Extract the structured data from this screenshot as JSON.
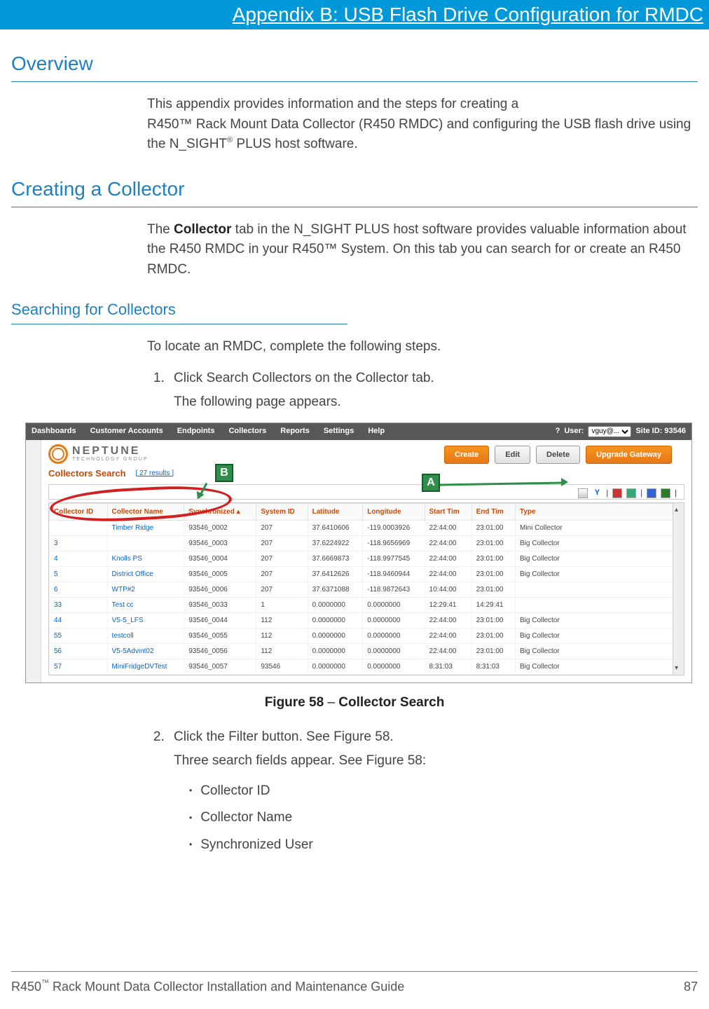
{
  "header_title": "Appendix B: USB Flash Drive Configuration for RMDC",
  "overview": {
    "heading": "Overview",
    "para1_a": "This appendix provides information and the steps for creating a",
    "para1_b": "R450™ Rack Mount Data Collector (R450 RMDC) and configuring the USB flash drive using the N_SIGHT",
    "para1_c": " PLUS host software."
  },
  "creating": {
    "heading": "Creating a Collector",
    "para_a": "The ",
    "para_bold1": "Collector",
    "para_b": " tab in the N_SIGHT PLUS host software provides valuable information about the R450 RMDC in your R450™ System. On this tab you can search for or create an R450 RMDC."
  },
  "searching": {
    "heading": "Searching for Collectors",
    "intro": "To locate an RMDC, complete the following steps.",
    "step1_a": "Click ",
    "step1_b": "Search Collectors",
    "step1_c": " on the ",
    "step1_d": "Collector",
    "step1_e": " tab.",
    "step1_sub": "The following page appears.",
    "step2_a": "Click the ",
    "step2_b": "Filter",
    "step2_c": " button. See Figure 58.",
    "step2_sub": "Three search fields appear. See Figure 58:",
    "bullets": [
      "Collector ID",
      "Collector Name",
      "Synchronized User"
    ]
  },
  "figure": {
    "caption_num": "Figure 58",
    "caption_sep": "  –  ",
    "caption_title": "Collector Search"
  },
  "shot": {
    "menu": [
      "Dashboards",
      "Customer Accounts",
      "Endpoints",
      "Collectors",
      "Reports",
      "Settings",
      "Help"
    ],
    "user_label": "User:",
    "user_value": "vguy@...",
    "site_label": "Site ID: 93546",
    "help_q": "?",
    "logo_big": "NEPTUNE",
    "logo_small": "TECHNOLOGY GROUP",
    "btn_create": "Create",
    "btn_edit": "Edit",
    "btn_delete": "Delete",
    "btn_upgrade": "Upgrade Gateway",
    "search_title": "Collectors Search",
    "results": "[ 27 results ]",
    "filter_y": "Y",
    "columns": [
      "Collector ID",
      "Collector Name",
      "Synchronized ▴",
      "System ID",
      "Latitude",
      "Longitude",
      "Start Tim",
      "End Tim",
      "Type"
    ],
    "rows": [
      {
        "id": "",
        "name": "Timber Ridge",
        "sync": "93546_0002",
        "sys": "207",
        "lat": "37.6410606",
        "lon": "-119.0003926",
        "st": "22:44:00",
        "et": "23:01:00",
        "type": "Mini Collector"
      },
      {
        "id": "3",
        "name": "",
        "sync": "93546_0003",
        "sys": "207",
        "lat": "37.6224922",
        "lon": "-118.9656969",
        "st": "22:44:00",
        "et": "23:01:00",
        "type": "Big Collector"
      },
      {
        "id": "4",
        "name": "Knolls PS",
        "sync": "93546_0004",
        "sys": "207",
        "lat": "37.6669873",
        "lon": "-118.9977545",
        "st": "22:44:00",
        "et": "23:01:00",
        "type": "Big Collector"
      },
      {
        "id": "5",
        "name": "District Office",
        "sync": "93546_0005",
        "sys": "207",
        "lat": "37.6412626",
        "lon": "-118.9460944",
        "st": "22:44:00",
        "et": "23:01:00",
        "type": "Big Collector"
      },
      {
        "id": "6",
        "name": "WTP#2",
        "sync": "93546_0006",
        "sys": "207",
        "lat": "37.6371088",
        "lon": "-118.9872643",
        "st": "10:44:00",
        "et": "23:01:00",
        "type": ""
      },
      {
        "id": "33",
        "name": "Test cc",
        "sync": "93546_0033",
        "sys": "1",
        "lat": "0.0000000",
        "lon": "0.0000000",
        "st": "12:29:41",
        "et": "14:29:41",
        "type": ""
      },
      {
        "id": "44",
        "name": "V5-5_LFS",
        "sync": "93546_0044",
        "sys": "112",
        "lat": "0.0000000",
        "lon": "0.0000000",
        "st": "22:44:00",
        "et": "23:01:00",
        "type": "Big Collector"
      },
      {
        "id": "55",
        "name": "testcoll",
        "sync": "93546_0055",
        "sys": "112",
        "lat": "0.0000000",
        "lon": "0.0000000",
        "st": "22:44:00",
        "et": "23:01:00",
        "type": "Big Collector"
      },
      {
        "id": "56",
        "name": "V5-5Advint02",
        "sync": "93546_0056",
        "sys": "112",
        "lat": "0.0000000",
        "lon": "0.0000000",
        "st": "22:44:00",
        "et": "23:01:00",
        "type": "Big Collector"
      },
      {
        "id": "57",
        "name": "MiniFridgeDVTest",
        "sync": "93546_0057",
        "sys": "93546",
        "lat": "0.0000000",
        "lon": "0.0000000",
        "st": "8:31:03",
        "et": "8:31:03",
        "type": "Big Collector"
      }
    ],
    "callout_A": "A",
    "callout_B": "B"
  },
  "footer": {
    "left_a": "R450",
    "left_b": " Rack Mount Data Collector Installation and Maintenance Guide",
    "page": "87"
  }
}
